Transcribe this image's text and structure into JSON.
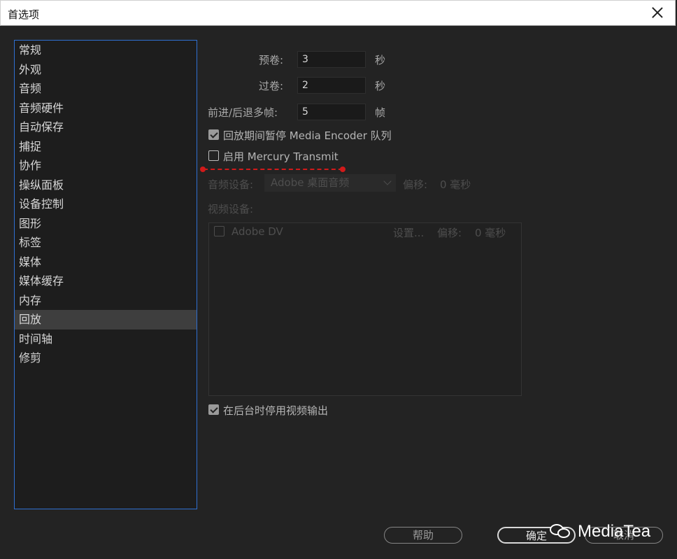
{
  "window": {
    "title": "首选项"
  },
  "sidebar": {
    "items": [
      {
        "label": "常规"
      },
      {
        "label": "外观"
      },
      {
        "label": "音频"
      },
      {
        "label": "音频硬件"
      },
      {
        "label": "自动保存"
      },
      {
        "label": "捕捉"
      },
      {
        "label": "协作"
      },
      {
        "label": "操纵面板"
      },
      {
        "label": "设备控制"
      },
      {
        "label": "图形"
      },
      {
        "label": "标签"
      },
      {
        "label": "媒体"
      },
      {
        "label": "媒体缓存"
      },
      {
        "label": "内存"
      },
      {
        "label": "回放"
      },
      {
        "label": "时间轴"
      },
      {
        "label": "修剪"
      }
    ],
    "selected": "回放"
  },
  "playback": {
    "preroll": {
      "label": "预卷:",
      "value": "3",
      "unit": "秒"
    },
    "postroll": {
      "label": "过卷:",
      "value": "2",
      "unit": "秒"
    },
    "step_frames": {
      "label": "前进/后退多帧:",
      "value": "5",
      "unit": "帧"
    },
    "pause_encoder": {
      "label": "回放期间暂停 Media Encoder 队列",
      "checked": true
    },
    "mercury_transmit": {
      "label": "启用 Mercury Transmit",
      "checked": false
    },
    "audio_device": {
      "label": "音频设备:",
      "value": "Adobe 桌面音频",
      "offset_label": "偏移:",
      "offset_value": "0 毫秒"
    },
    "video_device": {
      "label": "视频设备:",
      "devices": [
        {
          "name": "Adobe DV",
          "checked": false,
          "settings_label": "设置...",
          "offset_label": "偏移:",
          "offset_value": "0 毫秒"
        }
      ]
    },
    "disable_video_bg": {
      "label": "在后台时停用视频输出",
      "checked": true
    }
  },
  "buttons": {
    "help": "帮助",
    "ok": "确定",
    "cancel": "取消"
  },
  "watermark": {
    "text": "MediaTea",
    "icon": "wechat-icon"
  },
  "colors": {
    "accent_border": "#2f6fd2",
    "annotation": "#d11a1a",
    "background": "#232323"
  }
}
